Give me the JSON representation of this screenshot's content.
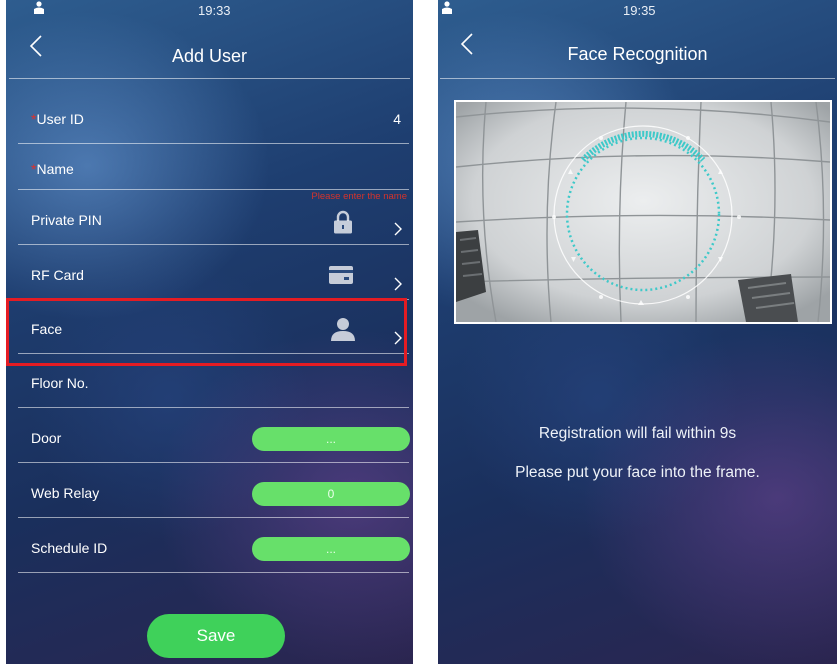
{
  "left_screen": {
    "status": {
      "time": "19:33"
    },
    "header": {
      "title": "Add User"
    },
    "fields": {
      "user_id": {
        "required_mark": "*",
        "label": "User ID",
        "value": "4"
      },
      "name": {
        "required_mark": "*",
        "label": "Name",
        "hint": "Please enter the name"
      },
      "private_pin": {
        "label": "Private PIN",
        "icon": "lock-icon"
      },
      "rf_card": {
        "label": "RF Card",
        "icon": "card-icon"
      },
      "face": {
        "label": "Face",
        "icon": "person-icon"
      },
      "floor_no": {
        "label": "Floor No."
      },
      "door": {
        "label": "Door",
        "value": "..."
      },
      "web_relay": {
        "label": "Web Relay",
        "value": "0"
      },
      "schedule_id": {
        "label": "Schedule ID",
        "value": "..."
      }
    },
    "save_label": "Save"
  },
  "right_screen": {
    "status": {
      "time": "19:35"
    },
    "header": {
      "title": "Face Recognition"
    },
    "message_line1": "Registration will fail within 9s",
    "message_line2": "Please put your face into the frame."
  },
  "colors": {
    "highlight": "#e51c23",
    "pill_green": "#67e06a",
    "save_green": "#3fd15a",
    "required_red": "#e0302a",
    "face_ring": "#3ec9c9"
  }
}
